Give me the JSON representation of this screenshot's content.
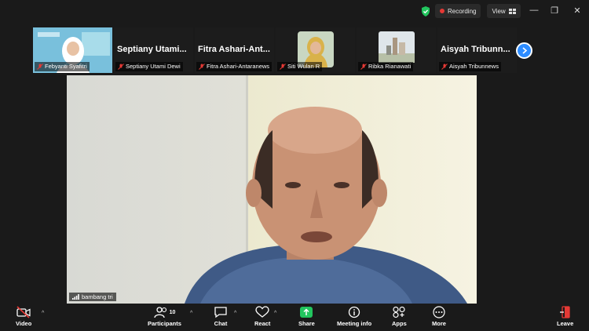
{
  "topbar": {
    "recording_label": "Recording",
    "view_label": "View",
    "minimize_glyph": "—",
    "restore_glyph": "❐",
    "close_glyph": "✕"
  },
  "strip": {
    "tiles": [
      {
        "name_big": "",
        "label": "Febyanti Syafitri"
      },
      {
        "name_big": "Septiany Utami...",
        "label": "Septiany Utami Dewi"
      },
      {
        "name_big": "Fitra Ashari-Ant...",
        "label": "Fitra Ashari-Antaranews"
      },
      {
        "name_big": "",
        "label": "Siti Wulan R"
      },
      {
        "name_big": "",
        "label": "Ribka Rianawati"
      },
      {
        "name_big": "Aisyah Tribunn...",
        "label": "Aisyah Tribunnews"
      }
    ]
  },
  "main": {
    "speaker_label": "bambang tri"
  },
  "toolbar": {
    "video": "Video",
    "participants": "Participants",
    "participants_count": "10",
    "chat": "Chat",
    "react": "React",
    "share": "Share",
    "meeting_info": "Meeting info",
    "apps": "Apps",
    "more": "More",
    "leave": "Leave"
  },
  "colors": {
    "accent": "#2d8cff",
    "share_green": "#22c55e",
    "muted_red": "#e53935",
    "background": "#1a1a1a"
  }
}
